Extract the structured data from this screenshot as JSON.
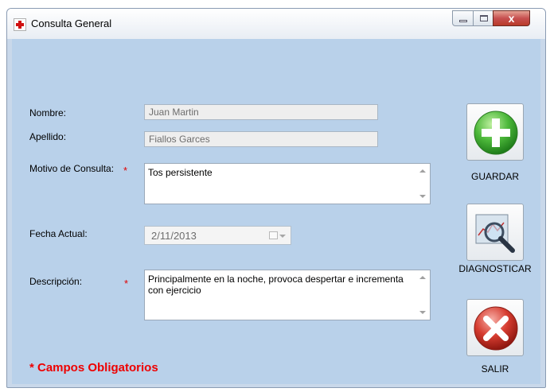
{
  "window": {
    "title": "Consulta General",
    "close_glyph": "x"
  },
  "form": {
    "nombre": {
      "label": "Nombre:",
      "value": "Juan Martin"
    },
    "apellido": {
      "label": "Apellido:",
      "value": "Fiallos Garces"
    },
    "motivo": {
      "label": "Motivo de Consulta:",
      "value": "Tos persistente",
      "required_mark": "*"
    },
    "fecha": {
      "label": "Fecha Actual:",
      "value": "2/11/2013"
    },
    "descripcion": {
      "label": "Descripción:",
      "value": "Principalmente en la noche, provoca despertar e incrementa con ejercicio",
      "required_mark": "*"
    }
  },
  "actions": {
    "guardar": {
      "label": "GUARDAR",
      "icon": "plus-icon",
      "color": "#3aa83a"
    },
    "diagnosticar": {
      "label": "DIAGNOSTICAR",
      "icon": "magnifier-chart-icon",
      "color": "#5a8fc0"
    },
    "salir": {
      "label": "SALIR",
      "icon": "close-icon",
      "color": "#cc2a2a"
    }
  },
  "footer": {
    "required_note": "* Campos Obligatorios"
  }
}
